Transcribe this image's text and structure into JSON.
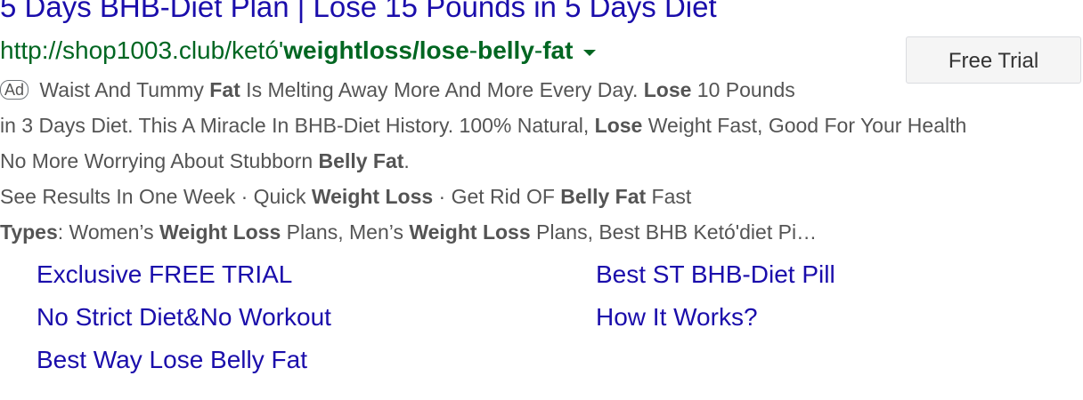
{
  "ad": {
    "headline": "5 Days BHB-Diet Plan | Lose 15 Pounds in 5 Days Diet",
    "url_prefix": "http://shop1003.club/ketó'",
    "url_bold_1": "weightloss",
    "url_sep": "/",
    "url_bold_2": "lose",
    "url_dash_1": "-",
    "url_bold_3": "belly",
    "url_dash_2": "-",
    "url_bold_4": "fat",
    "cta_label": "Free Trial",
    "badge": "Ad",
    "line1": {
      "t1": " Waist And Tummy ",
      "b1": "Fat",
      "t2": " Is Melting Away More And More Every Day. ",
      "b2": "Lose",
      "t3": " 10 Pounds"
    },
    "line2": {
      "t1": "in 3 Days Diet. This A Miracle In BHB-Diet History. 100% Natural, ",
      "b1": "Lose",
      "t2": " Weight Fast, Good For Your Health"
    },
    "line3": {
      "t1": "No More Worrying About Stubborn ",
      "b1": "Belly Fat",
      "t2": "."
    },
    "line4": {
      "t1": "See Results In One Week · Quick ",
      "b1": "Weight Loss",
      "t2": " · Get Rid OF ",
      "b2": "Belly Fat",
      "t3": " Fast"
    },
    "line5": {
      "b1": "Types",
      "t1": ": Women’s ",
      "b2": "Weight Loss",
      "t2": " Plans, Men’s ",
      "b3": "Weight Loss",
      "t3": " Plans, Best BHB Ketó'diet Pi…"
    },
    "sitelinks": [
      "Exclusive FREE TRIAL",
      "Best ST BHB-Diet Pill",
      "No Strict Diet&No Workout",
      "How It Works?",
      "Best Way Lose Belly Fat"
    ]
  },
  "colors": {
    "link": "#1a0dab",
    "url": "#006621",
    "text": "#545454"
  }
}
